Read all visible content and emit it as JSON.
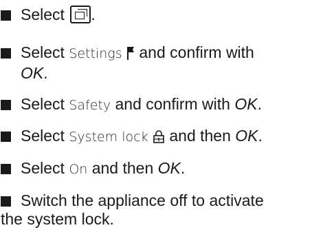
{
  "steps": [
    {
      "prefix": "Select",
      "suffix": "."
    },
    {
      "prefix": "Select",
      "ui_text": "Settings",
      "mid": "and confirm with",
      "line2": "OK",
      "end": "."
    },
    {
      "prefix": "Select",
      "ui_text": "Safety",
      "mid": "and confirm with",
      "em": "OK",
      "end": "."
    },
    {
      "prefix": "Select",
      "ui_text": "System lock",
      "mid": "and then",
      "em": "OK",
      "end": "."
    },
    {
      "prefix": "Select",
      "ui_text": "On",
      "mid": "and then",
      "em": "OK",
      "end": "."
    },
    {
      "line1": "Switch the appliance off to activate",
      "line2": "the system lock."
    }
  ],
  "icons": {
    "step1": "menu-windows-icon",
    "step2": "settings-flag-icon",
    "step4": "padlock-icon"
  }
}
